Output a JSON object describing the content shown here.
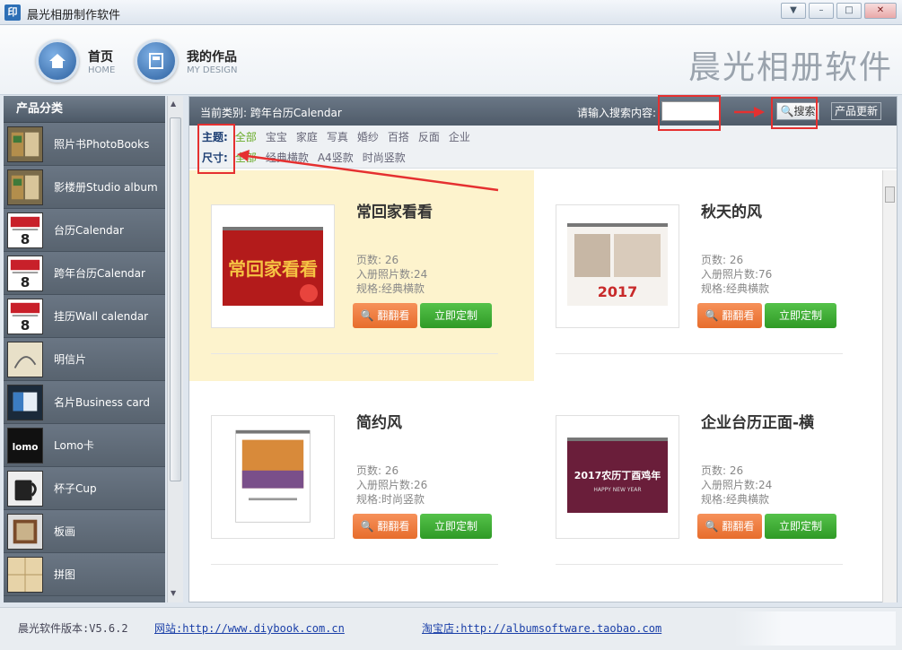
{
  "window": {
    "icon_text": "印",
    "title": "晨光相册制作软件",
    "buttons": {
      "menu": "▼",
      "minimize": "–",
      "maximize": "□",
      "close": "✕"
    }
  },
  "header": {
    "home": {
      "label": "首页",
      "sub": "HOME",
      "icon": "home-icon"
    },
    "my_design": {
      "label": "我的作品",
      "sub": "MY DESIGN",
      "icon": "document-icon"
    },
    "brand": "晨光相册软件"
  },
  "sidebar": {
    "title": "产品分类",
    "items": [
      {
        "label": "照片书PhotoBooks",
        "thumb": "photobook"
      },
      {
        "label": "影楼册Studio album",
        "thumb": "photobook"
      },
      {
        "label": "台历Calendar",
        "thumb": "calendar"
      },
      {
        "label": "跨年台历Calendar",
        "thumb": "calendar"
      },
      {
        "label": "挂历Wall calendar",
        "thumb": "calendar"
      },
      {
        "label": "明信片",
        "thumb": "postcard"
      },
      {
        "label": "名片Business card",
        "thumb": "card"
      },
      {
        "label": "Lomo卡",
        "thumb": "lomo"
      },
      {
        "label": "杯子Cup",
        "thumb": "cup"
      },
      {
        "label": "板画",
        "thumb": "frame"
      },
      {
        "label": "拼图",
        "thumb": "puzzle"
      }
    ]
  },
  "toolbar": {
    "current_category": "当前类别: 跨年台历Calendar",
    "search_label": "请输入搜索内容:",
    "search_value": "",
    "search_button": "搜索",
    "update_button": "产品更新"
  },
  "filters": {
    "theme_title": "主题:",
    "theme_options": [
      "全部",
      "宝宝",
      "家庭",
      "写真",
      "婚纱",
      "百搭",
      "反面",
      "企业"
    ],
    "theme_active": 0,
    "size_title": "尺寸:",
    "size_options": [
      "全部",
      "经典横款",
      "A4竖款",
      "时尚竖款"
    ],
    "size_active": 0
  },
  "products": [
    {
      "title": "常回家看看",
      "pages": "页数:  26",
      "photos": "入册照片数:24",
      "spec": "规格:经典横款",
      "flip": "翻翻看",
      "order": "立即定制",
      "highlight": true,
      "art": "red"
    },
    {
      "title": "秋天的风",
      "pages": "页数:  26",
      "photos": "入册照片数:76",
      "spec": "规格:经典横款",
      "flip": "翻翻看",
      "order": "立即定制",
      "highlight": false,
      "art": "autumn"
    },
    {
      "title": "简约风",
      "pages": "页数:  26",
      "photos": "入册照片数:26",
      "spec": "规格:时尚竖款",
      "flip": "翻翻看",
      "order": "立即定制",
      "highlight": false,
      "art": "lavender"
    },
    {
      "title": "企业台历正面-横",
      "pages": "页数:  26",
      "photos": "入册照片数:24",
      "spec": "规格:经典横款",
      "flip": "翻翻看",
      "order": "立即定制",
      "highlight": false,
      "art": "corp"
    }
  ],
  "statusbar": {
    "version": "晨光软件版本:V5.6.2",
    "site": "网站:http://www.diybook.com.cn",
    "shop": "淘宝店:http://albumsoftware.taobao.com"
  },
  "colors": {
    "accent_orange": "#e76d2c",
    "accent_green": "#2f9a26",
    "filter_active": "#6aac2a",
    "annotation": "#e53030"
  }
}
